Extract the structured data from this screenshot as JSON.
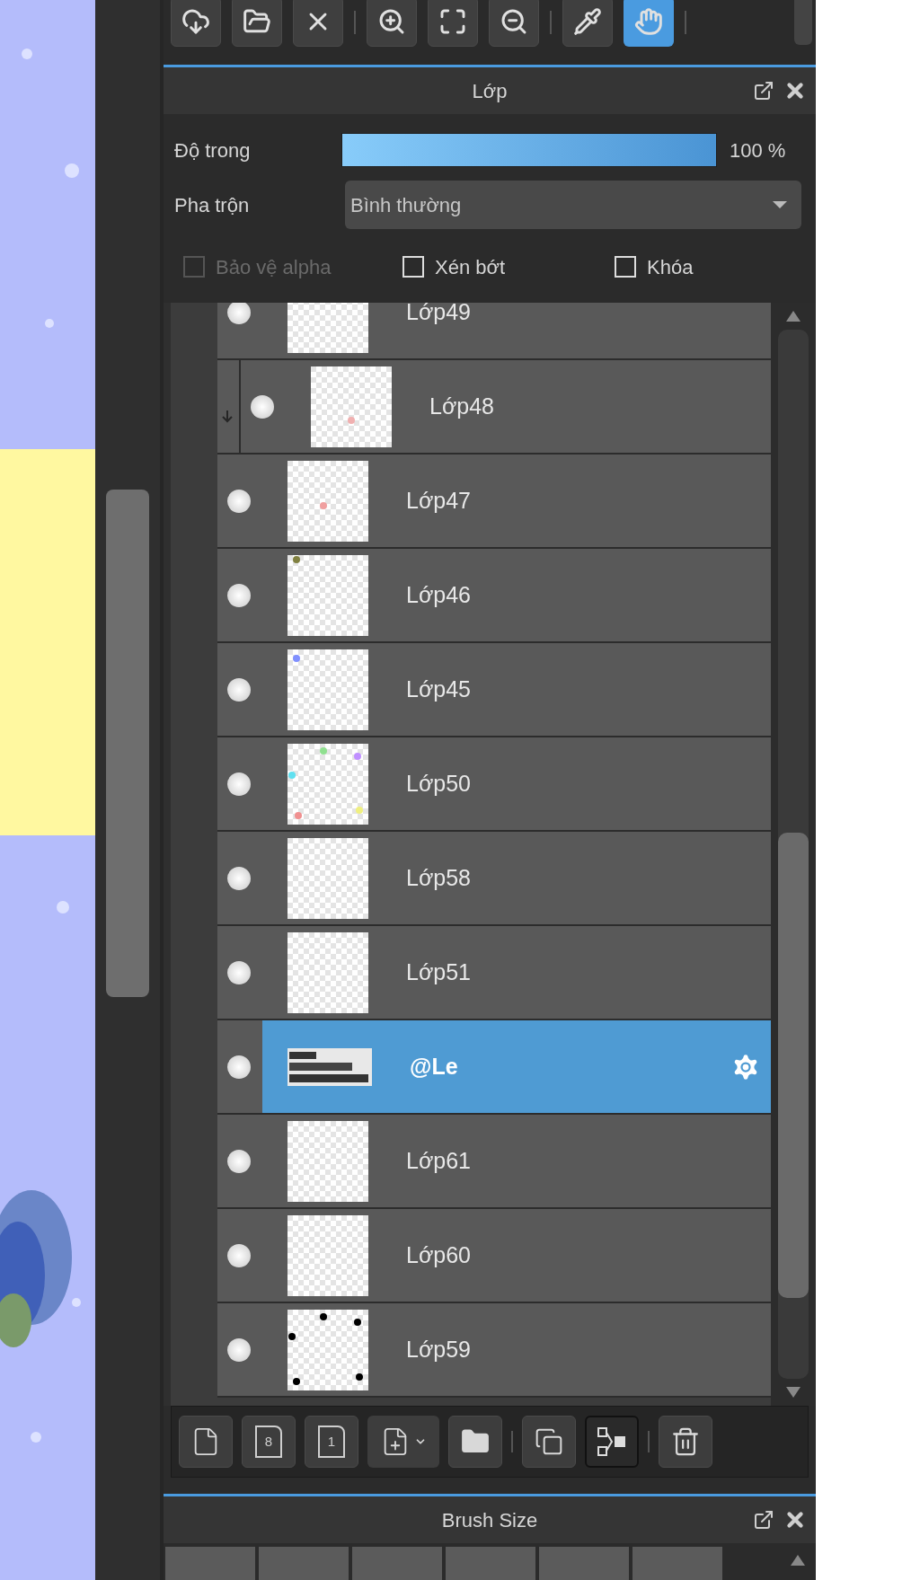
{
  "toolbar": [
    {
      "kind": "cloud",
      "selected": false
    },
    {
      "kind": "open",
      "selected": false
    },
    {
      "kind": "close",
      "selected": false
    },
    {
      "kind": "sep"
    },
    {
      "kind": "zoom-in",
      "selected": false
    },
    {
      "kind": "fit",
      "selected": false
    },
    {
      "kind": "zoom-out",
      "selected": false
    },
    {
      "kind": "sep"
    },
    {
      "kind": "eyedropper",
      "selected": false
    },
    {
      "kind": "hand",
      "selected": true
    },
    {
      "kind": "sep"
    }
  ],
  "layer_panel": {
    "title": "Lớp",
    "opacity": {
      "label": "Độ trong",
      "level": 1,
      "reading": "100 %"
    },
    "blend": {
      "label": "Pha trộn",
      "value": "Bình thường"
    },
    "options": [
      {
        "label": "Bảo vệ alpha",
        "checked": false,
        "disabled": true
      },
      {
        "label": "Xén bớt",
        "checked": false,
        "disabled": false
      },
      {
        "label": "Khóa",
        "checked": false,
        "disabled": false
      }
    ],
    "layers": [
      {
        "name": "Lớp49",
        "visible": true,
        "clipped": false,
        "selected": false
      },
      {
        "name": "Lớp48",
        "visible": true,
        "clipped": true,
        "selected": false
      },
      {
        "name": "Lớp47",
        "visible": true,
        "clipped": false,
        "selected": false
      },
      {
        "name": "Lớp46",
        "visible": true,
        "clipped": false,
        "selected": false
      },
      {
        "name": "Lớp45",
        "visible": true,
        "clipped": false,
        "selected": false
      },
      {
        "name": "Lớp50",
        "visible": true,
        "clipped": false,
        "selected": false
      },
      {
        "name": "Lớp58",
        "visible": true,
        "clipped": false,
        "selected": false
      },
      {
        "name": "Lớp51",
        "visible": true,
        "clipped": false,
        "selected": false
      },
      {
        "name": "@Le",
        "visible": true,
        "clipped": false,
        "selected": true
      },
      {
        "name": "Lớp61",
        "visible": true,
        "clipped": false,
        "selected": false
      },
      {
        "name": "Lớp60",
        "visible": true,
        "clipped": false,
        "selected": false
      },
      {
        "name": "Lớp59",
        "visible": true,
        "clipped": false,
        "selected": false
      }
    ],
    "actions": [
      {
        "kind": "new"
      },
      {
        "kind": "new-digit",
        "glyph": "8"
      },
      {
        "kind": "new-digit",
        "glyph": "1"
      },
      {
        "kind": "add-menu"
      },
      {
        "kind": "folder"
      },
      {
        "kind": "sep"
      },
      {
        "kind": "duplicate"
      },
      {
        "kind": "merge"
      },
      {
        "kind": "sep"
      },
      {
        "kind": "delete"
      }
    ]
  },
  "brush_panel": {
    "title": "Brush Size"
  }
}
